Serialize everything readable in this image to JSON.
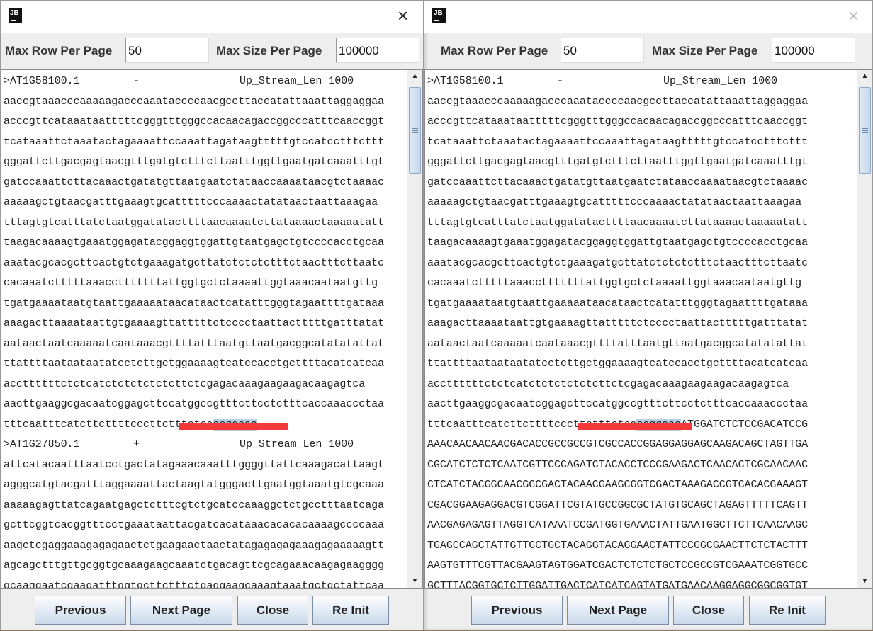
{
  "windows": [
    {
      "logo": "JB",
      "close_icon": "×",
      "max_row_label": "Max Row Per Page",
      "max_row_value": "50",
      "max_size_label": "Max Size Per Page",
      "max_size_value": "100000",
      "lines": [
        {
          "h": [
            ">AT1G58100.1",
            "-",
            "Up_Stream_Len 1000"
          ]
        },
        {
          "t": "aaccgtaaacccaaaaagacccaaataccccaacgccttaccatattaaattaggaggaa"
        },
        {
          "t": "acccgttcataaataatttttcgggtttgggccacaacagaccggcccatttcaaccggt"
        },
        {
          "t": "tcataaattctaaatactagaaaattccaaattagataagtttttgtccatcctttcttt"
        },
        {
          "t": "gggattcttgacgagtaacgtttgatgtctttcttaatttggttgaatgatcaaatttgt"
        },
        {
          "t": "gatccaaattcttacaaactgatatgttaatgaatctataaccaaaataacgtctaaaac"
        },
        {
          "t": "aaaaagctgtaacgatttgaaagtgcatttttcccaaaactatataactaattaaagaa"
        },
        {
          "t": "tttagtgtcatttatctaatggatatacttttaacaaaatcttataaaactaaaaatatt"
        },
        {
          "t": "taagacaaaagtgaaatggagatacggaggtggattgtaatgagctgtccccacctgcaa"
        },
        {
          "t": "aaatacgcacgcttcactgtctgaaagatgcttatctctctctttctaactttcttaatc"
        },
        {
          "t": "cacaaatctttttaaacctttttttattggtgctctaaaattggtaaacaataatgttg"
        },
        {
          "t": "tgatgaaaataatgtaattgaaaaataacataactcatatttgggtagaattttgataaa"
        },
        {
          "t": "aaagacttaaaataattgtgaaaagttatttttctcccctaattactttttgatttatat"
        },
        {
          "t": "aataactaatcaaaaatcaataaacgttttatttaatgttaatgacggcatatatattat"
        },
        {
          "t": "ttattttaataataatatcctcttgctggaaaagtcatccacctgcttttacatcatcaa"
        },
        {
          "t": "accttttttctctcatctctctctctcttctcgagacaaagaagaagacaagagtca"
        },
        {
          "t": "aacttgaaggcgacaatcggagcttccatggccgtttcttcctctttcaccaaaccctaa"
        },
        {
          "t": "tttcaatttcatcttcttttcccttctttctca",
          "s": "ccggaaa",
          "p": ""
        },
        {
          "h": [
            ">AT1G27850.1",
            "+",
            "Up_Stream_Len 1000"
          ]
        },
        {
          "t": "attcatacaatttaatcctgactatagaaacaaatttggggttattcaaagacattaagt"
        },
        {
          "t": "agggcatgtacgatttaggaaaattactaagtatgggacttgaatggtaaatgtcgcaaa"
        },
        {
          "t": "aaaaagagttatcagaatgagctctttcgtctgcatccaaaggctctgcctttaatcaga"
        },
        {
          "t": "gcttcggtcacggtttcctgaaataattacgatcacataaacacacacaaaagccccaaa"
        },
        {
          "t": "aagctcgaggaaagagagaactctgaagaactaactatagagagagaaagagaaaaagtt"
        },
        {
          "t": "agcagctttgttgcggtgcaaagaagcaaatctgacagttcgcagaaacaagagaagggg"
        },
        {
          "t": "gcaaggaatcgaagatttggtgcttctttctgaggaagcaaagtaaatgctgctattcaa"
        }
      ],
      "buttons": [
        "Previous",
        "Next Page",
        "Close",
        "Re Init"
      ]
    },
    {
      "logo": "JB",
      "close_icon": "×",
      "max_row_label": "Max Row Per Page",
      "max_row_value": "50",
      "max_size_label": "Max Size Per Page",
      "max_size_value": "100000",
      "lines": [
        {
          "h": [
            ">AT1G58100.1",
            "-",
            "Up_Stream_Len 1000"
          ]
        },
        {
          "t": "aaccgtaaacccaaaaagacccaaataccccaacgccttaccatattaaattaggaggaa"
        },
        {
          "t": "acccgttcataaataatttttcgggtttgggccacaacagaccggcccatttcaaccggt"
        },
        {
          "t": "tcataaattctaaatactagaaaattccaaattagataagtttttgtccatcctttcttt"
        },
        {
          "t": "gggattcttgacgagtaacgtttgatgtctttcttaatttggttgaatgatcaaatttgt"
        },
        {
          "t": "gatccaaattcttacaaactgatatgttaatgaatctataaccaaaataacgtctaaaac"
        },
        {
          "t": "aaaaagctgtaacgatttgaaagtgcatttttcccaaaactatataactaattaaagaa"
        },
        {
          "t": "tttagtgtcatttatctaatggatatacttttaacaaaatcttataaaactaaaaatatt"
        },
        {
          "t": "taagacaaaagtgaaatggagatacggaggtggattgtaatgagctgtccccacctgcaa"
        },
        {
          "t": "aaatacgcacgcttcactgtctgaaagatgcttatctctctctttctaactttcttaatc"
        },
        {
          "t": "cacaaatctttttaaacctttttttattggtgctctaaaattggtaaacaataatgttg"
        },
        {
          "t": "tgatgaaaataatgtaattgaaaaataacataactcatatttgggtagaattttgataaa"
        },
        {
          "t": "aaagacttaaaataattgtgaaaagttatttttctcccctaattactttttgatttatat"
        },
        {
          "t": "aataactaatcaaaaatcaataaacgttttatttaatgttaatgacggcatatatattat"
        },
        {
          "t": "ttattttaataataatatcctcttgctggaaaagtcatccacctgcttttacatcatcaa"
        },
        {
          "t": "accttttttctctcatctctctctctcttctcgagacaaagaagaagacaagagtca"
        },
        {
          "t": "aacttgaaggcgacaatcggagcttccatggccgtttcttcctctttcaccaaaccctaa"
        },
        {
          "t": "tttcaatttcatcttcttttcccttctttctca",
          "s": "ccggaaa",
          "p": "ATGGATCTCTCCGACATCCG"
        },
        {
          "t": "AAACAACAACAACGACACCGCCGCCGTCGCCACCGGAGGAGGAGCAAGACAGCTAGTTGA"
        },
        {
          "t": "CGCATCTCTCTCAATCGTTCCCAGATCTACACCTCCCGAAGACTCAACACTCGCAACAAC"
        },
        {
          "t": "CTCATCTACGGCAACGGCGACTACAACGAAGCGGTCGACTAAAGACCGTCACACGAAAGT"
        },
        {
          "t": "CGACGGAAGAGGACGTCGGATTCGTATGCCGGCGCTATGTGCAGCTAGAGTTTTTCAGTT"
        },
        {
          "t": "AACGAGAGAGTTAGGTCATAAATCCGATGGTGAAACTATTGAATGGCTTCTTCAACAAGC"
        },
        {
          "t": "TGAGCCAGCTATTGTTGCTGCTACAGGTACAGGAACTATTCCGGCGAACTTCTCTACTTT"
        },
        {
          "t": "AAGTGTTTCGTTACGAAGTAGTGGATCGACTCTCTCTGCTCCGCCGTCGAAATCGGTGCC"
        },
        {
          "t": "GCTTTACGGTGCTCTTGGATTGACTCATCATCAGTATGATGAACAAGGAGGCGGCGGTGT"
        }
      ],
      "buttons": [
        "Previous",
        "Next Page",
        "Close",
        "Re Init"
      ]
    }
  ],
  "colors": {
    "selection": "#b8cfe5",
    "underline": "#f5383a",
    "button_top": "#fdfeff",
    "button_bottom": "#c9d9ea"
  }
}
